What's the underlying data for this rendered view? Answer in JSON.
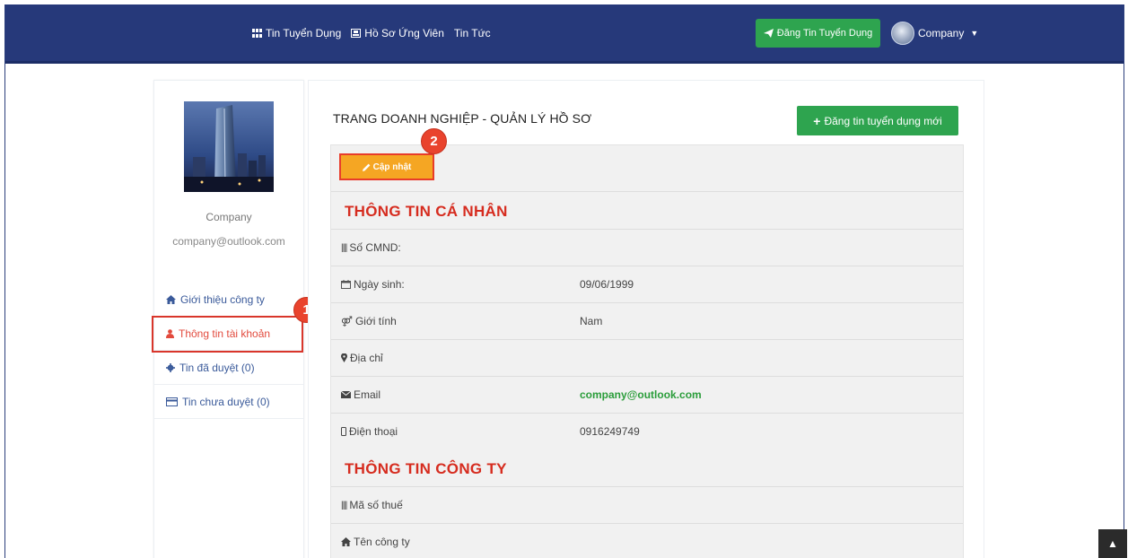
{
  "nav": {
    "links": [
      {
        "label": "Tin Tuyển Dụng",
        "icon": "grid-icon"
      },
      {
        "label": "Hồ Sơ Ứng Viên",
        "icon": "id-card-icon"
      },
      {
        "label": "Tin Tức",
        "icon": ""
      }
    ],
    "post_button": "Đăng Tin Tuyển Dụng",
    "user_label": "Company"
  },
  "sidebar": {
    "company_name": "Company",
    "company_email": "company@outlook.com",
    "items": [
      {
        "label": "Giới thiệu công ty",
        "icon": "home-icon"
      },
      {
        "label": "Thông tin tài khoản",
        "icon": "user-icon"
      },
      {
        "label": "Tin đã duyệt (0)",
        "icon": "gear-icon"
      },
      {
        "label": "Tin chưa duyệt (0)",
        "icon": "card-icon"
      }
    ]
  },
  "main": {
    "title": "TRANG DOANH NGHIỆP - QUẢN LÝ HỒ SƠ",
    "new_post_button": "Đăng tin tuyển dụng mới",
    "update_button": "Cập nhật",
    "personal_heading": "THÔNG TIN CÁ NHÂN",
    "personal_rows": [
      {
        "label": "Số CMND:",
        "value": "",
        "icon": "barcode-icon"
      },
      {
        "label": "Ngày sinh:",
        "value": "09/06/1999",
        "icon": "calendar-icon"
      },
      {
        "label": "Giới tính",
        "value": "Nam",
        "icon": "gender-icon"
      },
      {
        "label": "Địa chỉ",
        "value": "",
        "icon": "map-marker-icon"
      },
      {
        "label": "Email",
        "value": "company@outlook.com",
        "icon": "envelope-icon"
      },
      {
        "label": "Điện thoại",
        "value": "0916249749",
        "icon": "phone-icon"
      }
    ],
    "company_heading": "THÔNG TIN CÔNG TY",
    "company_rows": [
      {
        "label": "Mã số thuế",
        "value": "",
        "icon": "barcode-icon"
      },
      {
        "label": "Tên công ty",
        "value": "",
        "icon": "home-icon"
      }
    ]
  },
  "annotations": {
    "step1": "1",
    "step2": "2"
  },
  "colors": {
    "navbar": "#26397a",
    "primary_green": "#2ea44f",
    "update_orange": "#f5a623",
    "heading_red": "#d62c1f",
    "highlight_red": "#d9362b"
  }
}
